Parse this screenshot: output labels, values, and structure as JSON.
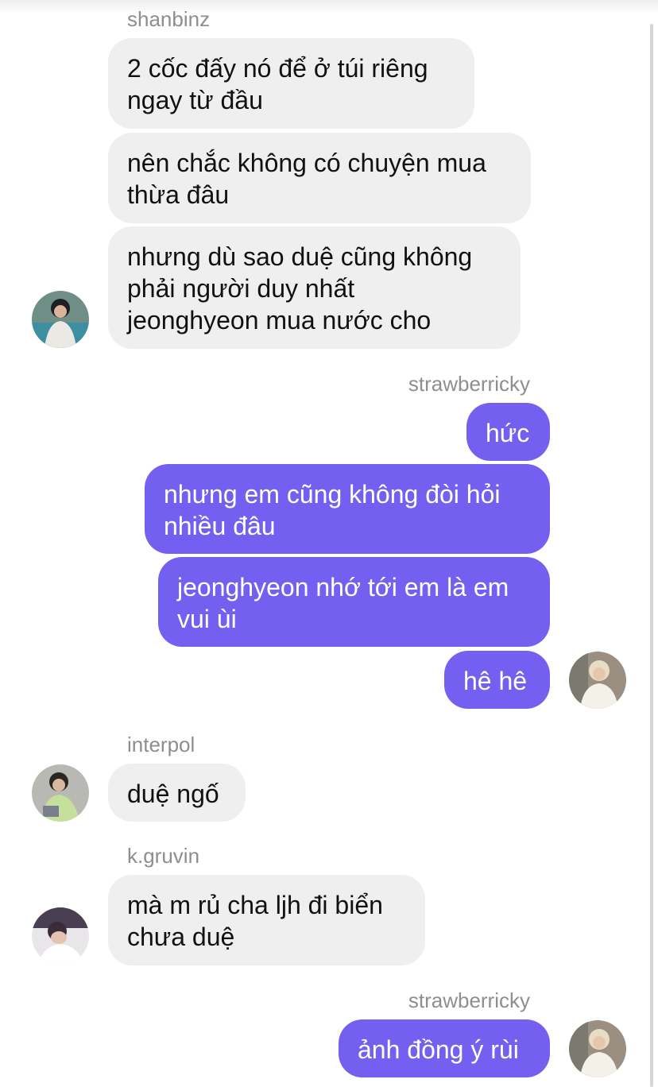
{
  "colors": {
    "outgoing_bubble": "#7360f1",
    "incoming_bubble": "#efefef",
    "sender_text": "#8e8e8e"
  },
  "messages": [
    {
      "sender": "shanbinz",
      "direction": "incoming",
      "bubbles": [
        "2 cốc đấy nó để ở túi riêng\nngay từ đầu",
        "nên chắc không có chuyện mua\nthừa đâu",
        "nhưng dù sao duệ cũng không\nphải người duy nhất\njeonghyeon mua nước cho"
      ],
      "avatar": "profile-photo"
    },
    {
      "sender": "strawberricky",
      "direction": "outgoing",
      "bubbles": [
        "hức",
        "nhưng em cũng không đòi hỏi\nnhiều đâu",
        "jeonghyeon nhớ tới em là em\nvui ùi",
        "hê hê"
      ],
      "avatar": "profile-photo"
    },
    {
      "sender": "interpol",
      "direction": "incoming",
      "bubbles": [
        "duệ ngố"
      ],
      "avatar": "profile-photo"
    },
    {
      "sender": "k.gruvin",
      "direction": "incoming",
      "bubbles": [
        "mà m rủ cha ljh đi biển\nchưa duệ"
      ],
      "avatar": "profile-photo"
    },
    {
      "sender": "strawberricky",
      "direction": "outgoing",
      "bubbles": [
        "ảnh đồng ý rùi"
      ],
      "avatar": "profile-photo"
    }
  ]
}
